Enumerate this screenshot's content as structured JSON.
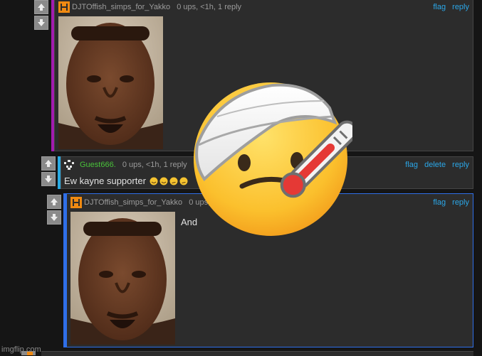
{
  "comments": [
    {
      "user": "DJTOffish_simps_for_Yakko",
      "meta": "0 ups, <1h, 1 reply",
      "actions": [
        "flag",
        "reply"
      ],
      "thread_color": "#a21caf"
    },
    {
      "user": "Guest666.",
      "meta": "0 ups, <1h, 1 reply",
      "actions": [
        "flag",
        "delete",
        "reply"
      ],
      "text": "Ew kayne supporter",
      "thread_color": "#29a9e1"
    },
    {
      "user": "DJTOffish_simps_for_Yakko",
      "meta": "0 ups, <1h",
      "actions": [
        "flag",
        "reply"
      ],
      "text": "And",
      "thread_color": "#2f6fe8"
    }
  ],
  "overlay": {
    "icon": "face-with-head-bandage-and-thermometer-emoji"
  },
  "watermark": "imgflip.com",
  "colors": {
    "link": "#2ba7e8",
    "guest_name": "#49c23a",
    "background": "#151515",
    "panel": "#2c2c2c"
  }
}
